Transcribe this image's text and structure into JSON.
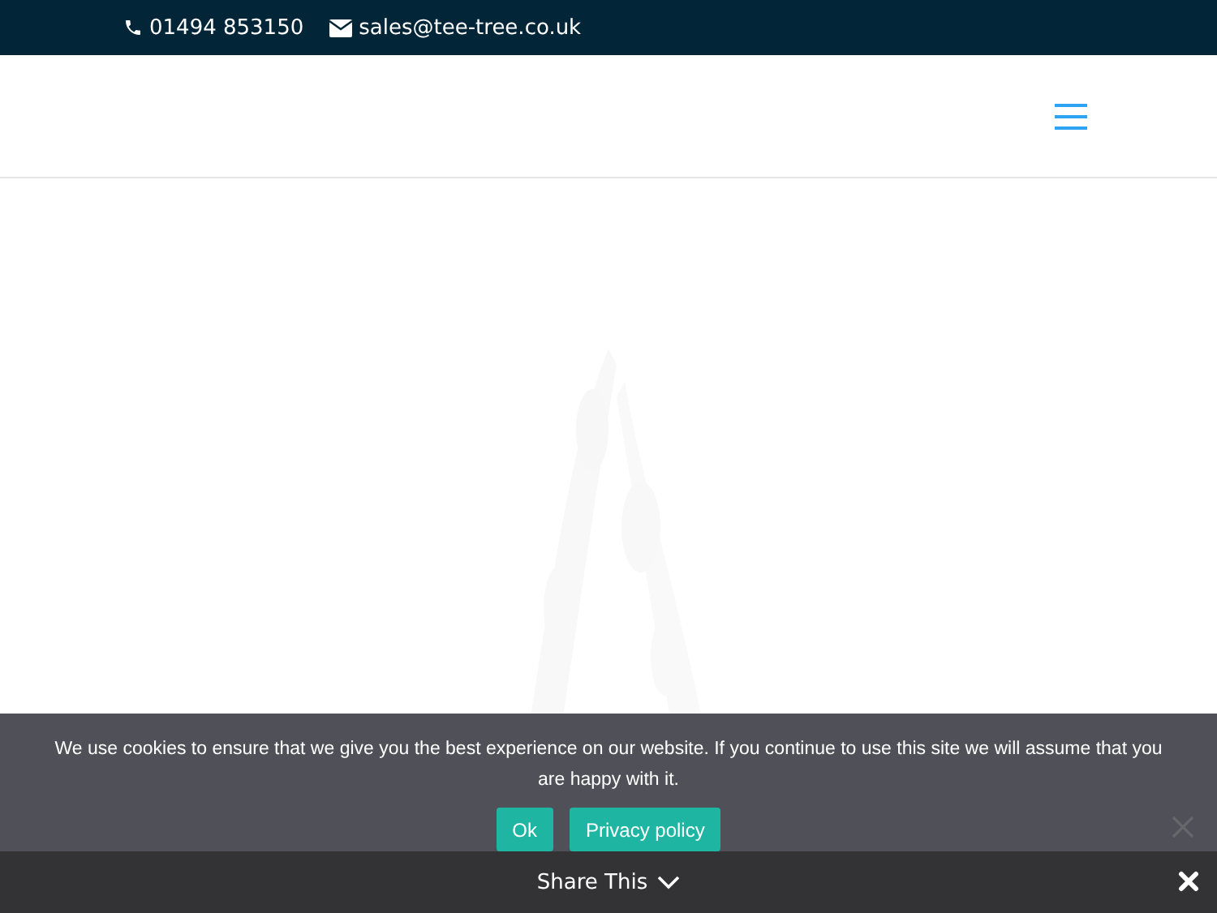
{
  "top_bar": {
    "phone": "01494 853150",
    "email": "sales@tee-tree.co.uk"
  },
  "cookie_notice": {
    "text": "We use cookies to ensure that we give you the best experience on our website. If you continue to use this site we will assume that you are happy with it.",
    "buttons": [
      "Ok",
      "Privacy policy"
    ]
  },
  "share_bar": {
    "label": "Share This"
  }
}
